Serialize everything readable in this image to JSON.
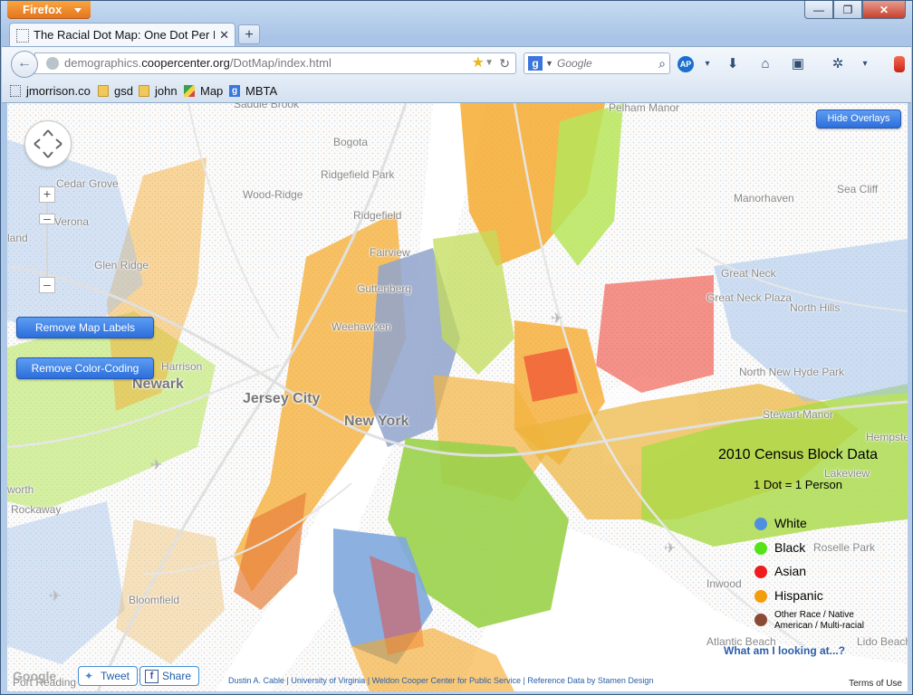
{
  "browser": {
    "app_button": "Firefox",
    "window_controls": {
      "minimize": "—",
      "maximize": "❐",
      "close": "✕"
    },
    "tab": {
      "title": "The Racial Dot Map: One Dot Per Person...",
      "close": "✕"
    },
    "new_tab": "+",
    "address": {
      "prefix": "demographics.",
      "domain": "coopercenter.org",
      "path": "/DotMap/index.html"
    },
    "search": {
      "engine": "g",
      "placeholder": "Google"
    },
    "bookmarks": [
      {
        "label": "jmorrison.co",
        "icon": "page-icon"
      },
      {
        "label": "gsd",
        "icon": "folder-icon"
      },
      {
        "label": "john",
        "icon": "folder-icon"
      },
      {
        "label": "Map",
        "icon": "maps-icon"
      },
      {
        "label": "MBTA",
        "icon": "google-icon"
      }
    ]
  },
  "map": {
    "buttons": {
      "hide_overlays": "Hide Overlays",
      "remove_labels": "Remove Map Labels",
      "remove_color": "Remove Color-Coding"
    },
    "place_labels": [
      "Saddle Brook",
      "Bogota",
      "Pelham Manor",
      "Cedar Grove",
      "Wood-Ridge",
      "Ridgefield Park",
      "Manorhaven",
      "Sea Cliff",
      "Verona",
      "Ridgefield",
      "Fairview",
      "Glen Ridge",
      "Great Neck",
      "Great Neck Plaza",
      "North Hills",
      "Guttenberg",
      "Weehawken",
      "Harrison",
      "Newark",
      "Jersey City",
      "New York",
      "North New Hyde Park",
      "Stewart Manor",
      "Hempstead",
      "Lakeview",
      "Roselle Park",
      "Rockaway",
      "Inwood",
      "Bloomfield",
      "Atlantic Beach",
      "Lido Beach",
      "Port Reading",
      "land",
      "worth"
    ],
    "legend": {
      "title": "2010 Census Block Data",
      "subtitle": "1 Dot = 1 Person",
      "items": [
        {
          "label": "White",
          "color": "#4f8fe0"
        },
        {
          "label": "Black",
          "color": "#56e21a"
        },
        {
          "label": "Asian",
          "color": "#ee1c1c"
        },
        {
          "label": "Hispanic",
          "color": "#f59c0d"
        },
        {
          "label": "Other Race / Native American / Multi-racial",
          "color": "#8b4a35"
        }
      ]
    },
    "what_link": "What am I looking at...?",
    "tweet": "Tweet",
    "share": "Share",
    "credits": "Dustin A. Cable | University of Virginia | Weldon Cooper Center for Public Service | Reference Data by Stamen Design",
    "terms": "Terms of Use",
    "watermark": "Google"
  }
}
